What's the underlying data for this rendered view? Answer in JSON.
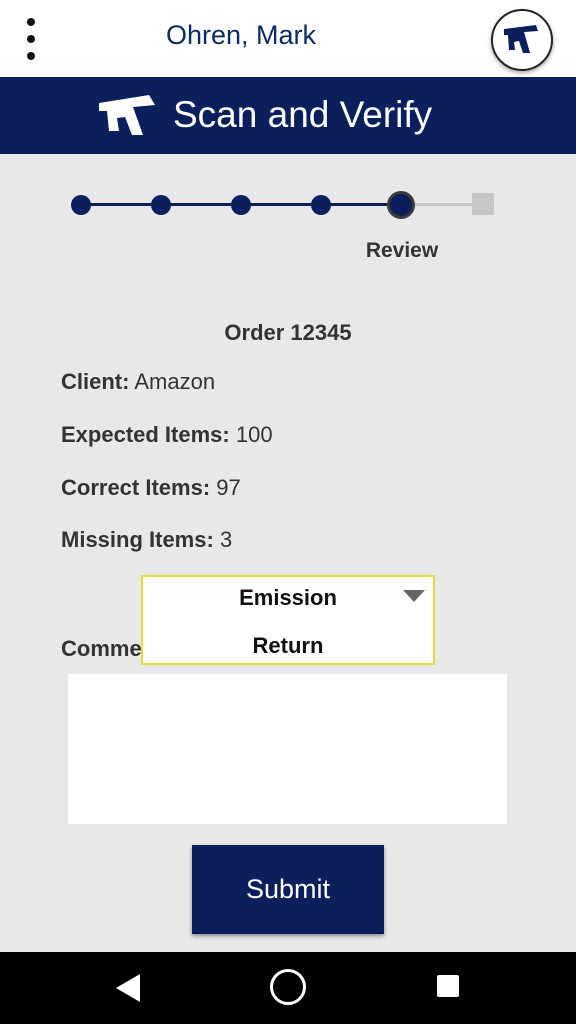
{
  "topbar": {
    "user_name": "Ohren, Mark",
    "menu_icon": "more-vert-icon",
    "avatar_icon": "app-logo-icon"
  },
  "header": {
    "title": "Scan and Verify",
    "logo_icon": "app-logo-icon"
  },
  "stepper": {
    "current_label": "Review",
    "current_step": 5,
    "total_steps": 6
  },
  "order": {
    "title": "Order 12345",
    "client_label": "Client:",
    "client_value": "Amazon",
    "expected_label": "Expected Items:",
    "expected_value": "100",
    "correct_label": "Correct Items:",
    "correct_value": "97",
    "missing_label": "Missing Items:",
    "missing_value": "3"
  },
  "comments": {
    "label": "Comme",
    "value": ""
  },
  "dropdown": {
    "options": [
      "Emission",
      "Return"
    ],
    "selected": "Emission"
  },
  "submit_label": "Submit",
  "nav": {
    "back_icon": "back-icon",
    "home_icon": "home-icon",
    "recent_icon": "recent-apps-icon"
  },
  "colors": {
    "brand_navy": "#0b1f5c",
    "background": "#e8e8e8",
    "dropdown_border": "#e6dc3a"
  }
}
